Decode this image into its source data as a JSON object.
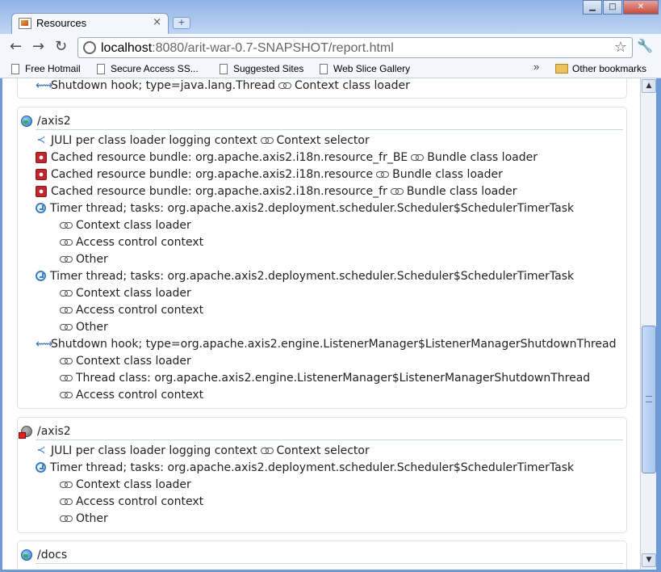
{
  "window": {
    "tab_title": "Resources",
    "tab_close": "×",
    "new_tab": "+",
    "minimize": "▁",
    "maximize": "□",
    "close": "✕"
  },
  "toolbar": {
    "back": "←",
    "forward": "→",
    "reload": "↻",
    "url_host": "localhost",
    "url_rest": ":8080/arit-war-0.7-SNAPSHOT/report.html",
    "star": "☆",
    "wrench": "🔧"
  },
  "bookmarks": {
    "items": [
      "Free Hotmail",
      "Secure Access SS...",
      "Suggested Sites",
      "Web Slice Gallery"
    ],
    "overflow": "»",
    "other": "Other bookmarks"
  },
  "sections": [
    {
      "type": "partial",
      "rows": [
        {
          "icon": "hook",
          "text": "Shutdown hook; type=java.lang.Thread",
          "rel": "Context class loader"
        }
      ]
    },
    {
      "title": "/axis2",
      "rows": [
        {
          "icon": "share",
          "text": "JULI per class loader logging context",
          "rel": "Context selector"
        },
        {
          "icon": "bundle",
          "text": "Cached resource bundle: org.apache.axis2.i18n.resource_fr_BE",
          "rel": "Bundle class loader"
        },
        {
          "icon": "bundle",
          "text": "Cached resource bundle: org.apache.axis2.i18n.resource",
          "rel": "Bundle class loader"
        },
        {
          "icon": "bundle",
          "text": "Cached resource bundle: org.apache.axis2.i18n.resource_fr",
          "rel": "Bundle class loader"
        },
        {
          "icon": "timer",
          "text": "Timer thread; tasks: org.apache.axis2.deployment.scheduler.Scheduler$SchedulerTimerTask"
        },
        {
          "icon": "link",
          "text": "Context class loader"
        },
        {
          "icon": "link",
          "text": "Access control context"
        },
        {
          "icon": "link",
          "text": "Other"
        },
        {
          "icon": "timer",
          "text": "Timer thread; tasks: org.apache.axis2.deployment.scheduler.Scheduler$SchedulerTimerTask"
        },
        {
          "icon": "link",
          "text": "Context class loader"
        },
        {
          "icon": "link",
          "text": "Access control context"
        },
        {
          "icon": "link",
          "text": "Other"
        },
        {
          "icon": "hook",
          "text": "Shutdown hook; type=org.apache.axis2.engine.ListenerManager$ListenerManagerShutdownThread"
        },
        {
          "icon": "link",
          "text": "Context class loader"
        },
        {
          "icon": "link",
          "text": "Thread class: org.apache.axis2.engine.ListenerManager$ListenerManagerShutdownThread"
        },
        {
          "icon": "link",
          "text": "Access control context"
        }
      ]
    },
    {
      "title": "/axis2",
      "rows": [
        {
          "icon": "share",
          "text": "JULI per class loader logging context",
          "rel": "Context selector"
        },
        {
          "icon": "timer",
          "text": "Timer thread; tasks: org.apache.axis2.deployment.scheduler.Scheduler$SchedulerTimerTask"
        },
        {
          "icon": "link",
          "text": "Context class loader"
        },
        {
          "icon": "link",
          "text": "Access control context"
        },
        {
          "icon": "link",
          "text": "Other"
        }
      ]
    },
    {
      "title": "/docs",
      "rows": []
    }
  ],
  "scrollbar": {
    "up": "▲",
    "down": "▼"
  }
}
